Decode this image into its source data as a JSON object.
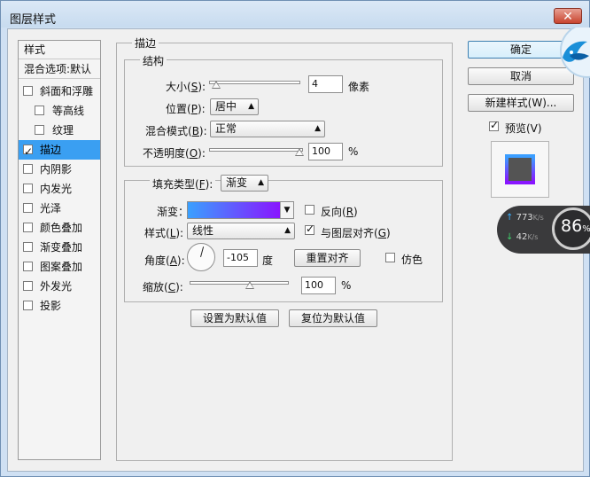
{
  "window": {
    "title": "图层样式",
    "close": "✕"
  },
  "left_list": {
    "header": "样式",
    "blend": "混合选项:默认",
    "items": [
      {
        "label": "斜面和浮雕",
        "checked": false,
        "selected": false
      },
      {
        "label": "等高线",
        "checked": false,
        "selected": false
      },
      {
        "label": "纹理",
        "checked": false,
        "selected": false
      },
      {
        "label": "描边",
        "checked": true,
        "selected": true
      },
      {
        "label": "内阴影",
        "checked": false,
        "selected": false
      },
      {
        "label": "内发光",
        "checked": false,
        "selected": false
      },
      {
        "label": "光泽",
        "checked": false,
        "selected": false
      },
      {
        "label": "颜色叠加",
        "checked": false,
        "selected": false
      },
      {
        "label": "渐变叠加",
        "checked": false,
        "selected": false
      },
      {
        "label": "图案叠加",
        "checked": false,
        "selected": false
      },
      {
        "label": "外发光",
        "checked": false,
        "selected": false
      },
      {
        "label": "投影",
        "checked": false,
        "selected": false
      }
    ]
  },
  "stroke": {
    "title": "描边",
    "structure": {
      "title": "结构",
      "size_label": "大小(",
      "size_key": "S",
      "size_value": "4",
      "size_unit": "像素",
      "position_label": "位置(",
      "position_key": "P",
      "position_value": "居中",
      "blend_label": "混合模式(",
      "blend_key": "B",
      "blend_value": "正常",
      "opacity_label": "不透明度(",
      "opacity_key": "O",
      "opacity_value": "100",
      "opacity_unit": "%"
    },
    "fill": {
      "type_label": "填充类型(",
      "type_key": "F",
      "type_value": "渐变",
      "gradient_label": "渐变：",
      "reverse_label": "反向(",
      "reverse_key": "R",
      "style_label": "样式(",
      "style_key": "L",
      "style_value": "线性",
      "align_label": "与图层对齐(",
      "align_key": "G",
      "angle_label": "角度(",
      "angle_key": "A",
      "angle_value": "-105",
      "angle_unit": "度",
      "reset_align": "重置对齐",
      "dither_label": "仿色",
      "scale_label": "缩放(",
      "scale_key": "C",
      "scale_value": "100",
      "scale_unit": "%"
    },
    "set_default": "设置为默认值",
    "reset_default": "复位为默认值"
  },
  "buttons": {
    "ok": "确定",
    "cancel": "取消",
    "new_style": "新建样式(W)...",
    "preview_label": "预览(V)"
  },
  "speed_widget": {
    "up": "773",
    "up_unit": "K/s",
    "down": "42",
    "down_unit": "K/s",
    "percent": "86",
    "percent_sign": "%"
  },
  "colors": {
    "gradient_start": "#3aa0ff",
    "gradient_end": "#8a14ff",
    "selection": "#3a9ff2"
  }
}
